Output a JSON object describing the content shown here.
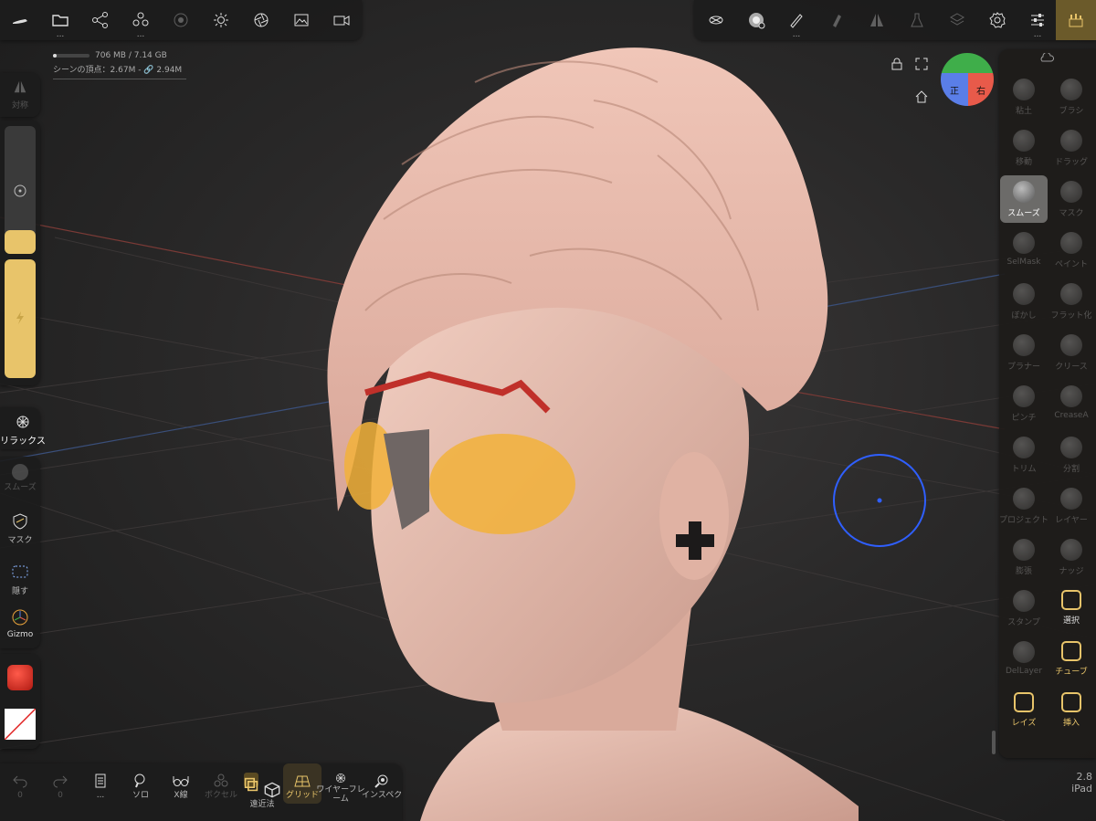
{
  "memory": {
    "usage": "706 MB / 7.14 GB",
    "vertices": "シーンの頂点：2.67M - 🔗 2.94M"
  },
  "top_left_toolbar": {
    "items": [
      "logo-icon",
      "folder-icon",
      "scene-graph-icon",
      "primitives-icon",
      "material-icon",
      "light-icon",
      "camera-icon",
      "image-icon",
      "video-icon"
    ]
  },
  "top_right_toolbar": {
    "items": [
      "topology-icon",
      "brush-alpha-icon",
      "stroke-icon",
      "painting-icon",
      "symmetry-icon",
      "flask-icon",
      "layers-icon",
      "settings-icon",
      "sliders-icon",
      "tools-icon"
    ]
  },
  "left_panel": {
    "symmetry_label": "対称",
    "relax_label": "リラックス",
    "smooth_label": "スムーズ",
    "mask_label": "マスク",
    "hide_label": "隠す",
    "gizmo_label": "Gizmo"
  },
  "view_cube": {
    "front": "正",
    "right": "右"
  },
  "tools": [
    {
      "label": "粘土",
      "active": false,
      "dim": true
    },
    {
      "label": "ブラシ",
      "active": false,
      "dim": true
    },
    {
      "label": "移動",
      "active": false,
      "dim": true
    },
    {
      "label": "ドラッグ",
      "active": false,
      "dim": true
    },
    {
      "label": "スムーズ",
      "active": true,
      "dim": true
    },
    {
      "label": "マスク",
      "active": false,
      "dim": true
    },
    {
      "label": "SelMask",
      "active": false,
      "dim": true
    },
    {
      "label": "ペイント",
      "active": false,
      "dim": true
    },
    {
      "label": "ぼかし",
      "active": false,
      "dim": true
    },
    {
      "label": "フラット化",
      "active": false,
      "dim": true
    },
    {
      "label": "プラナー",
      "active": false,
      "dim": true
    },
    {
      "label": "クリース",
      "active": false,
      "dim": true
    },
    {
      "label": "ピンチ",
      "active": false,
      "dim": true
    },
    {
      "label": "CreaseA",
      "active": false,
      "dim": true
    },
    {
      "label": "トリム",
      "active": false,
      "dim": true
    },
    {
      "label": "分割",
      "active": false,
      "dim": true
    },
    {
      "label": "プロジェクト",
      "active": false,
      "dim": true
    },
    {
      "label": "レイヤー",
      "active": false,
      "dim": true
    },
    {
      "label": "膨張",
      "active": false,
      "dim": true
    },
    {
      "label": "ナッジ",
      "active": false,
      "dim": true
    },
    {
      "label": "スタンプ",
      "active": false,
      "dim": true
    },
    {
      "label": "選択",
      "active": false,
      "dim": false
    },
    {
      "label": "DelLayer",
      "active": false,
      "dim": true
    },
    {
      "label": "チューブ",
      "active": false,
      "dim": false
    },
    {
      "label": "レイズ",
      "active": false,
      "dim": false
    },
    {
      "label": "挿入",
      "active": false,
      "dim": false
    }
  ],
  "bottom_toolbar": {
    "undo_count": "0",
    "redo_count": "0",
    "more": "...",
    "solo": "ソロ",
    "xray": "X線",
    "voxel": "ボクセル",
    "perspective": "遠近法",
    "grid": "グリッド",
    "wireframe": "ワイヤーフレーム",
    "inspector": "インスペクタ"
  },
  "version": {
    "number": "2.8",
    "platform": "iPad"
  },
  "colors": {
    "accent": "#e8c46a",
    "selection_circle": "#2f5fff",
    "model": "#e8b8a8"
  }
}
